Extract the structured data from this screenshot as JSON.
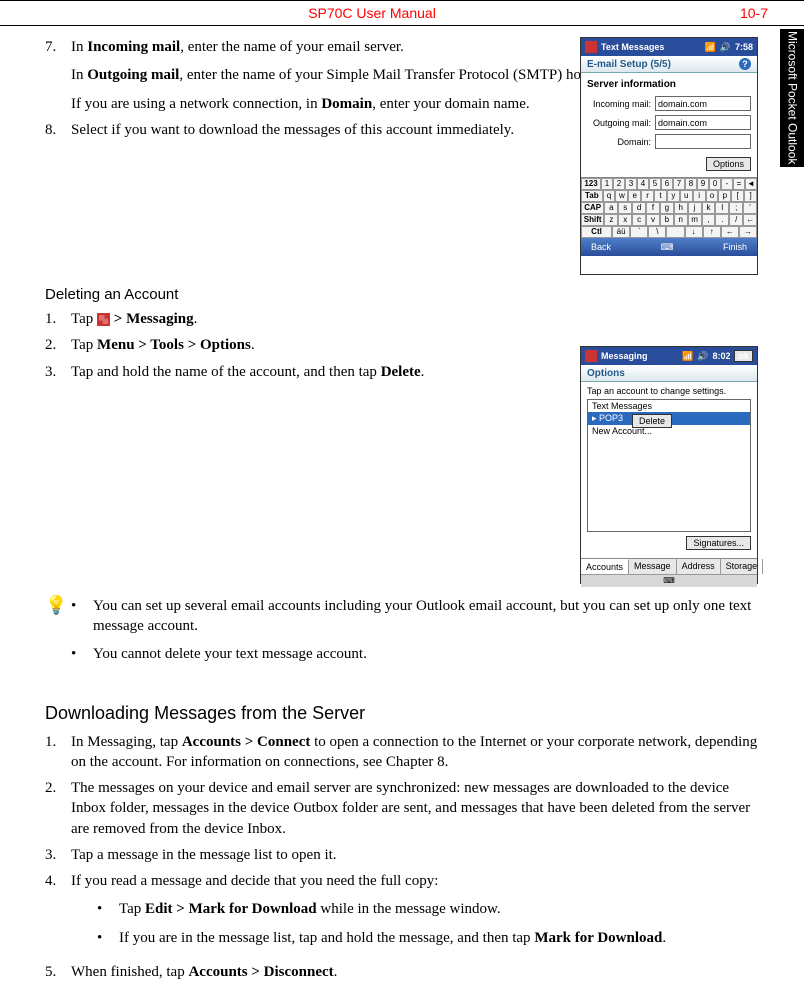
{
  "header": {
    "title": "SP70C User Manual",
    "page_number": "10-7"
  },
  "side_tab": "Microsoft Pocket Outlook",
  "section_a": {
    "items": [
      {
        "num": "7.",
        "paras": [
          {
            "pre": "In ",
            "bold": "Incoming mail",
            "post": ", enter the name of your email server."
          },
          {
            "pre": "In ",
            "bold": "Outgoing mail",
            "post": ", enter the name of your Simple Mail Transfer Protocol (SMTP) host."
          },
          {
            "pre": "If you are using a network connection, in ",
            "bold": "Domain",
            "post": ", enter your domain name."
          }
        ]
      },
      {
        "num": "8.",
        "paras": [
          {
            "pre": "Select if you want to download the messages of this account immediately.",
            "bold": "",
            "post": ""
          }
        ]
      }
    ]
  },
  "deleting": {
    "heading": "Deleting an Account",
    "items": [
      {
        "num": "1.",
        "pre": "Tap ",
        "icon": true,
        "bold": " > Messaging",
        "post": "."
      },
      {
        "num": "2.",
        "pre": "Tap ",
        "bold": "Menu > Tools > Options",
        "post": "."
      },
      {
        "num": "3.",
        "pre": "Tap and hold the name of the account, and then tap ",
        "bold": "Delete",
        "post": "."
      }
    ]
  },
  "notes": [
    "You can set up several email accounts including your Outlook email account, but you can set up only one text message account.",
    "You cannot delete your text message account."
  ],
  "downloading": {
    "heading": "Downloading Messages from the Server",
    "items": [
      {
        "num": "1.",
        "runs": [
          {
            "t": "In Messaging, tap "
          },
          {
            "t": "Accounts > Connect",
            "b": true
          },
          {
            "t": " to open a connection to the Internet or your corporate network, depending on the account. For information on connections, see Chapter 8."
          }
        ]
      },
      {
        "num": "2.",
        "runs": [
          {
            "t": "The messages on your device and email server are synchronized: new messages are downloaded to the device Inbox folder, messages in the device Outbox folder are sent, and messages that have been deleted from the server are removed from the device Inbox."
          }
        ]
      },
      {
        "num": "3.",
        "runs": [
          {
            "t": "Tap a message in the message list to open it."
          }
        ]
      },
      {
        "num": "4.",
        "runs": [
          {
            "t": "If you read a message and decide that you need the full copy:"
          }
        ],
        "sub": [
          {
            "runs": [
              {
                "t": "Tap "
              },
              {
                "t": "Edit > Mark for Download",
                "b": true
              },
              {
                "t": " while in the message window."
              }
            ]
          },
          {
            "runs": [
              {
                "t": "If you are in the message list, tap and hold the message, and then tap "
              },
              {
                "t": "Mark for Download",
                "b": true
              },
              {
                "t": "."
              }
            ]
          }
        ]
      },
      {
        "num": "5.",
        "runs": [
          {
            "t": "When finished, tap "
          },
          {
            "t": "Accounts > Disconnect",
            "b": true
          },
          {
            "t": "."
          }
        ]
      }
    ]
  },
  "fig1": {
    "title": "Text Messages",
    "time": "7:58",
    "sub": "E-mail Setup (5/5)",
    "section": "Server information",
    "rows": [
      {
        "label": "Incoming mail:",
        "value": "domain.com"
      },
      {
        "label": "Outgoing mail:",
        "value": "domain.com"
      },
      {
        "label": "Domain:",
        "value": ""
      }
    ],
    "options_btn": "Options",
    "kbd": {
      "r1": [
        "123",
        "1",
        "2",
        "3",
        "4",
        "5",
        "6",
        "7",
        "8",
        "9",
        "0",
        "-",
        "=",
        "◄"
      ],
      "r2": [
        "Tab",
        "q",
        "w",
        "e",
        "r",
        "t",
        "y",
        "u",
        "i",
        "o",
        "p",
        "[",
        "]"
      ],
      "r3": [
        "CAP",
        "a",
        "s",
        "d",
        "f",
        "g",
        "h",
        "j",
        "k",
        "l",
        ";",
        "'"
      ],
      "r4": [
        "Shift",
        "z",
        "x",
        "c",
        "v",
        "b",
        "n",
        "m",
        ",",
        ".",
        "/",
        "←"
      ],
      "r5": [
        "Ctl",
        "áü",
        "`",
        "\\",
        " ",
        "↓",
        "↑",
        "←",
        "→"
      ]
    },
    "back": "Back",
    "finish": "Finish"
  },
  "fig2": {
    "title": "Messaging",
    "time": "8:02",
    "ok": "ok",
    "sub": "Options",
    "instr": "Tap an account to change settings.",
    "list": [
      "Text Messages",
      "POP3",
      "New Account..."
    ],
    "selected_index": 1,
    "context_menu": "Delete",
    "signatures_btn": "Signatures...",
    "tabs": [
      "Accounts",
      "Message",
      "Address",
      "Storage"
    ],
    "active_tab": 0
  }
}
